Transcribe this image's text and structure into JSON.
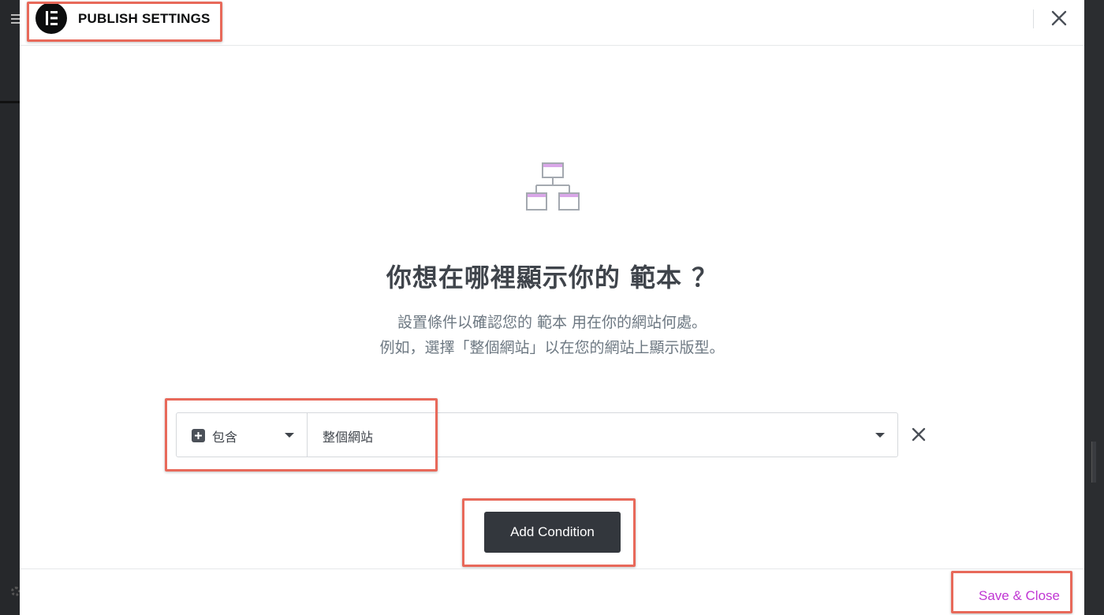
{
  "header": {
    "title": "PUBLISH SETTINGS",
    "logo_icon": "elementor-logo-icon",
    "close_icon": "close-icon"
  },
  "main": {
    "hero_icon": "sitemap-icon",
    "headline": "你想在哪裡顯示你的 範本 ？",
    "description_line1": "設置條件以確認您的 範本 用在你的網站何處。",
    "description_line2": "例如，選擇「整個網站」以在您的網站上顯示版型。"
  },
  "condition": {
    "type_label": "包含",
    "scope_label": "整個網站",
    "remove_icon": "close-icon"
  },
  "actions": {
    "add_condition_label": "Add Condition",
    "save_close_label": "Save & Close"
  },
  "colors": {
    "accent": "#c036d3",
    "primary_button": "#33373d",
    "highlight_box": "#e8695a",
    "icon_accent": "#d9a6e8",
    "icon_stroke": "#a4a9b0"
  }
}
